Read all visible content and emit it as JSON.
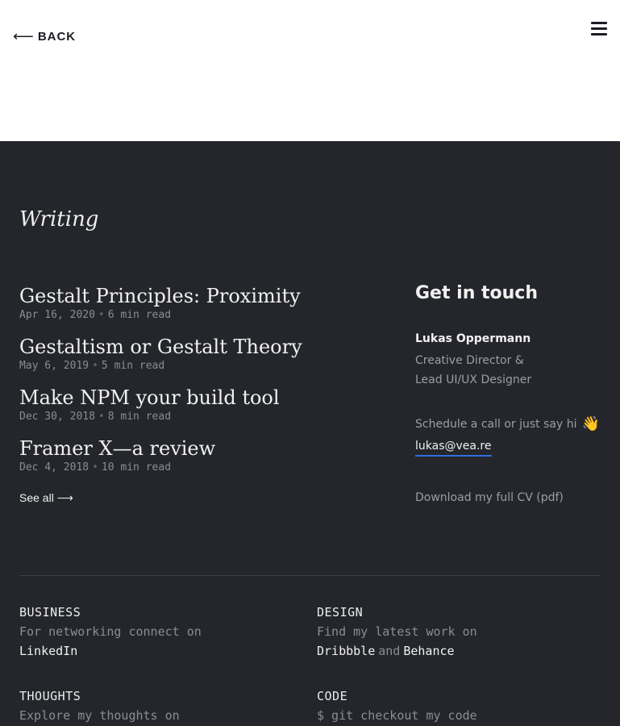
{
  "header": {
    "back_label": "BACK",
    "back_icon": "left-arrow-icon",
    "menu_icon": "hamburger-menu-icon"
  },
  "writing": {
    "title": "Writing",
    "articles": [
      {
        "title": "Gestalt Principles: Proximity",
        "date": "Apr 16, 2020",
        "read_time": "6 min read"
      },
      {
        "title": "Gestaltism or Gestalt Theory",
        "date": "May 6, 2019",
        "read_time": "5 min read"
      },
      {
        "title": "Make NPM your build tool",
        "date": "Dec 30, 2018",
        "read_time": "8 min read"
      },
      {
        "title": "Framer X—a review",
        "date": "Dec 4, 2018",
        "read_time": "10 min read"
      }
    ],
    "see_all_label": "See all ⟶"
  },
  "contact": {
    "heading": "Get in touch",
    "name": "Lukas Oppermann",
    "role_line1": "Creative Director &",
    "role_line2": "Lead UI/UX Designer",
    "cta": "Schedule a call or just say hi",
    "wave_emoji": "👋",
    "email": "lukas@vea.re",
    "cv_label": "Download my full CV (pdf)"
  },
  "footer": {
    "business": {
      "label": "BUSINESS",
      "text": "For networking connect on",
      "link": "LinkedIn"
    },
    "design": {
      "label": "DESIGN",
      "text": "Find my latest work on",
      "link1": "Dribbble",
      "separator": "and",
      "link2": "Behance"
    },
    "thoughts": {
      "label": "THOUGHTS",
      "text": "Explore my thoughts on"
    },
    "code": {
      "label": "CODE",
      "text": "$ git checkout my code"
    }
  },
  "colors": {
    "dark_background": "#24262b",
    "email_underline": "#2f6fe0"
  }
}
